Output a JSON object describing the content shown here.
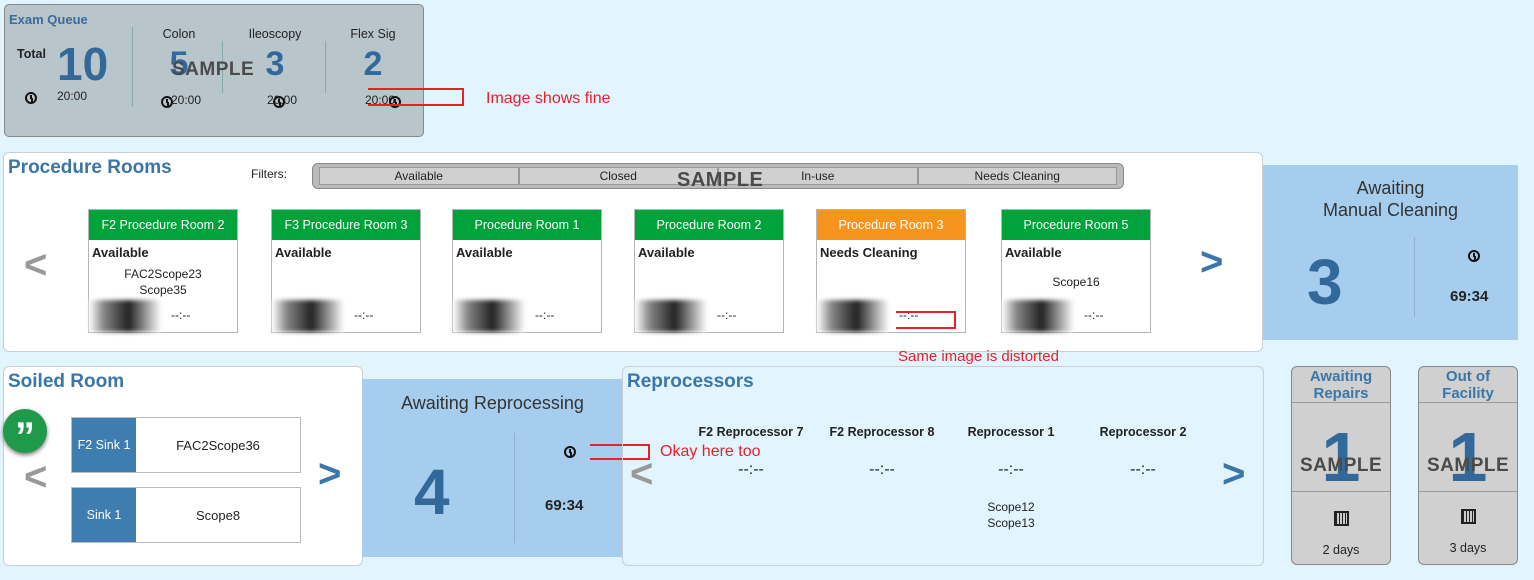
{
  "exam_queue": {
    "title": "Exam Queue",
    "total_label": "Total",
    "total": "10",
    "total_time": "20:00",
    "categories": [
      {
        "label": "Colon",
        "count": "5",
        "time": "20:00"
      },
      {
        "label": "Ileoscopy",
        "count": "3",
        "time": "20:00"
      },
      {
        "label": "Flex Sig",
        "count": "2",
        "time": "20:00"
      }
    ],
    "watermark": "SAMPLE"
  },
  "annotations": {
    "a1": "Image shows fine",
    "a2": "Same image is distorted",
    "a3": "Okay here too"
  },
  "procedure_rooms": {
    "title": "Procedure Rooms",
    "filters_label": "Filters:",
    "filters": [
      "Available",
      "Closed",
      "In-use",
      "Needs Cleaning"
    ],
    "watermark": "SAMPLE",
    "prev": "<",
    "next": ">",
    "rooms": [
      {
        "name": "F2 Procedure Room 2",
        "status": "Available",
        "scopes": [
          "FAC2Scope23",
          "Scope35"
        ],
        "time": "--:--"
      },
      {
        "name": "F3 Procedure Room 3",
        "status": "Available",
        "scopes": [],
        "time": "--:--"
      },
      {
        "name": "Procedure Room 1",
        "status": "Available",
        "scopes": [],
        "time": "--:--"
      },
      {
        "name": "Procedure Room 2",
        "status": "Available",
        "scopes": [],
        "time": "--:--"
      },
      {
        "name": "Procedure Room 3",
        "status": "Needs Cleaning",
        "scopes": [],
        "time": "--:--"
      },
      {
        "name": "Procedure Room 5",
        "status": "Available",
        "scopes": [
          "Scope16"
        ],
        "time": "--:--"
      }
    ]
  },
  "awaiting_manual": {
    "title1": "Awaiting",
    "title2": "Manual Cleaning",
    "count": "3",
    "time": "69:34"
  },
  "soiled_room": {
    "title": "Soiled Room",
    "prev": "<",
    "next": ">",
    "sinks": [
      {
        "label": "F2 Sink 1",
        "scope": "FAC2Scope36"
      },
      {
        "label": "Sink 1",
        "scope": "Scope8"
      }
    ],
    "quote_icon": "”"
  },
  "awaiting_reprocessing": {
    "title": "Awaiting Reprocessing",
    "count": "4",
    "time": "69:34"
  },
  "reprocessors": {
    "title": "Reprocessors",
    "prev": "<",
    "next": ">",
    "items": [
      {
        "name": "F2 Reprocessor 7",
        "time": "--:--",
        "scopes": ""
      },
      {
        "name": "F2 Reprocessor 8",
        "time": "--:--",
        "scopes": ""
      },
      {
        "name": "Reprocessor 1",
        "time": "--:--",
        "scope1": "Scope12",
        "scope2": "Scope13"
      },
      {
        "name": "Reprocessor 2",
        "time": "--:--",
        "scopes": ""
      }
    ]
  },
  "awaiting_repairs": {
    "title1": "Awaiting",
    "title2": "Repairs",
    "count": "1",
    "days": "2 days",
    "watermark": "SAMPLE"
  },
  "out_of_facility": {
    "title1": "Out of",
    "title2": "Facility",
    "count": "1",
    "days": "3 days",
    "watermark": "SAMPLE"
  },
  "colors": {
    "green": "#00a23a",
    "orange": "#f7941d",
    "blue": "#3a76a8",
    "light_blue": "#a7cdee"
  }
}
